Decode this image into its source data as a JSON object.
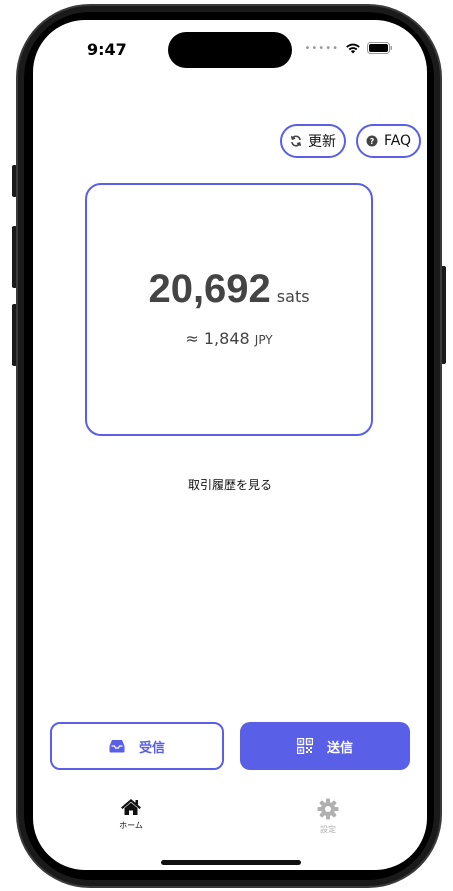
{
  "status_bar": {
    "time": "9:47",
    "signal_dots": "•••••"
  },
  "header": {
    "refresh_label": "更新",
    "faq_label": "FAQ"
  },
  "balance": {
    "amount": "20,692",
    "unit": "sats",
    "fiat_prefix": "≈ ",
    "fiat_amount": "1,848",
    "fiat_unit": "JPY"
  },
  "history_link": "取引履歴を見る",
  "actions": {
    "receive_label": "受信",
    "send_label": "送信"
  },
  "tab_bar": {
    "home_label": "ホーム",
    "settings_label": "設定"
  },
  "colors": {
    "accent": "#5a5fe8",
    "text_dark": "#444444",
    "tab_inactive": "#b0b0b0"
  },
  "icons": {
    "refresh": "refresh-icon",
    "faq": "question-circle-icon",
    "receive": "inbox-icon",
    "send": "qr-code-icon",
    "home": "home-icon",
    "settings": "gear-icon"
  }
}
